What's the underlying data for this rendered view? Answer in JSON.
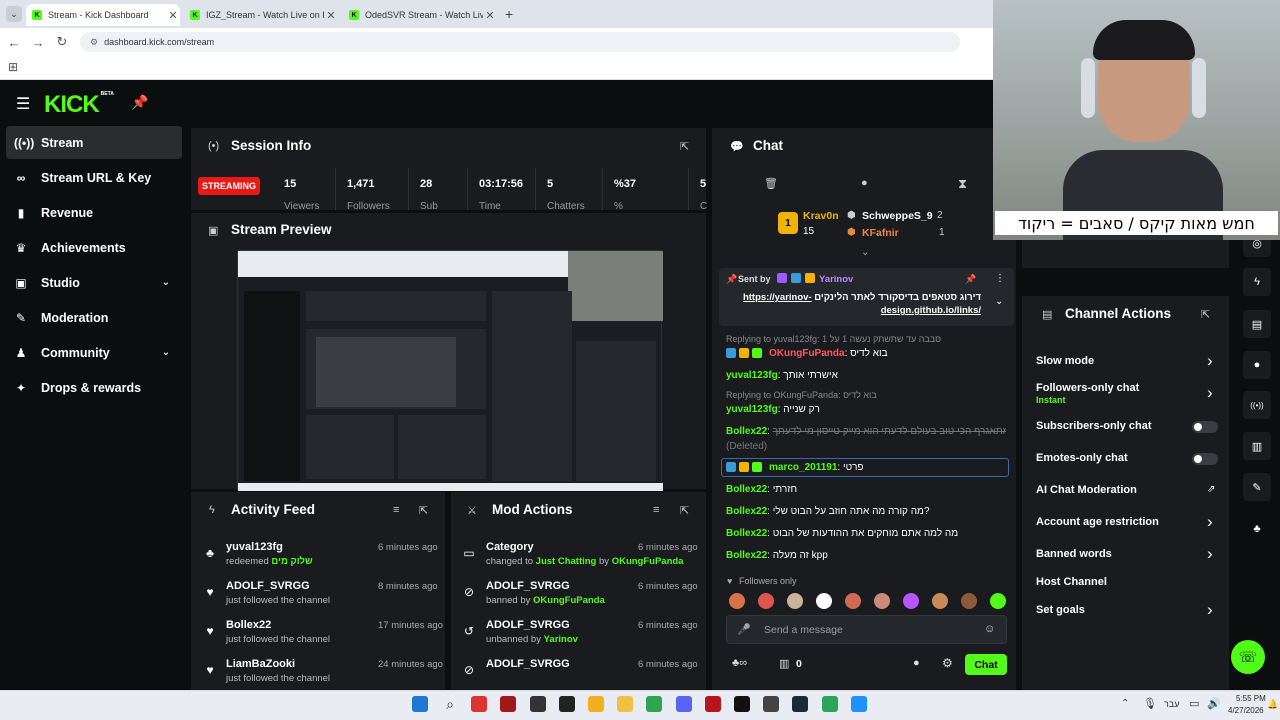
{
  "browser": {
    "tabs": [
      {
        "title": "Stream - Kick Dashboard",
        "active": true
      },
      {
        "title": "IGZ_Stream - Watch Live on Kick",
        "active": false
      },
      {
        "title": "OdedSVR Stream - Watch Live on Kick",
        "active": false
      }
    ],
    "new_tab": "+",
    "url": "dashboard.kick.com/stream"
  },
  "kick": {
    "logo": "KICK",
    "logo_badge": "BETA"
  },
  "sidebar": {
    "items": [
      {
        "label": "Stream",
        "icon": "broadcast-icon",
        "glyph": "((•))",
        "active": true,
        "expandable": false
      },
      {
        "label": "Stream URL & Key",
        "icon": "link-icon",
        "glyph": "∞",
        "active": false,
        "expandable": false
      },
      {
        "label": "Revenue",
        "icon": "chart-icon",
        "glyph": "▮",
        "active": false,
        "expandable": false
      },
      {
        "label": "Achievements",
        "icon": "trophy-icon",
        "glyph": "♛",
        "active": false,
        "expandable": false
      },
      {
        "label": "Studio",
        "icon": "studio-icon",
        "glyph": "▣",
        "active": false,
        "expandable": true
      },
      {
        "label": "Moderation",
        "icon": "wrench-icon",
        "glyph": "✎",
        "active": false,
        "expandable": false
      },
      {
        "label": "Community",
        "icon": "community-icon",
        "glyph": "♟",
        "active": false,
        "expandable": true
      },
      {
        "label": "Drops & rewards",
        "icon": "gift-icon",
        "glyph": "✦",
        "active": false,
        "expandable": false
      }
    ]
  },
  "session": {
    "title": "Session Info",
    "status": "STREAMING",
    "stats": [
      {
        "value": "15",
        "label": "Viewers"
      },
      {
        "value": "1,471",
        "label": "Followers"
      },
      {
        "value": "28",
        "label": "Sub"
      },
      {
        "value": "03:17:56",
        "label": "Time"
      },
      {
        "value": "5",
        "label": "Chatters"
      },
      {
        "value": "%37",
        "label": "%"
      },
      {
        "value": "5",
        "label": "C"
      }
    ]
  },
  "preview": {
    "title": "Stream Preview"
  },
  "activity": {
    "title": "Activity Feed",
    "items": [
      {
        "name": "yuval123fg",
        "sub": "redeemed",
        "extra": "שלוק מים",
        "time": "6 minutes ago",
        "icon": "redeem-icon"
      },
      {
        "name": "ADOLF_SVRGG",
        "sub": "just followed the channel",
        "extra": "",
        "time": "8 minutes ago",
        "icon": "heart-icon"
      },
      {
        "name": "Bollex22",
        "sub": "just followed the channel",
        "extra": "",
        "time": "17 minutes ago",
        "icon": "heart-icon"
      },
      {
        "name": "LiamBaZooki",
        "sub": "just followed the channel",
        "extra": "",
        "time": "24 minutes ago",
        "icon": "heart-icon"
      }
    ]
  },
  "modactions": {
    "title": "Mod Actions",
    "items": [
      {
        "name": "Category",
        "sub": "changed to",
        "extra": "Just Chatting",
        "by": "by",
        "actor": "OKungFuPanda",
        "time": "6 minutes ago",
        "icon": "category-icon"
      },
      {
        "name": "ADOLF_SVRGG",
        "sub": "banned by",
        "extra": "",
        "by": "",
        "actor": "OKungFuPanda",
        "time": "6 minutes ago",
        "icon": "ban-icon"
      },
      {
        "name": "ADOLF_SVRGG",
        "sub": "unbanned by",
        "extra": "",
        "by": "",
        "actor": "Yarinov",
        "time": "6 minutes ago",
        "icon": "unban-icon"
      },
      {
        "name": "ADOLF_SVRGG",
        "sub": "",
        "extra": "",
        "by": "",
        "actor": "",
        "time": "6 minutes ago",
        "icon": "ban-icon"
      }
    ]
  },
  "chat": {
    "title": "Chat",
    "leaderboard": {
      "first": {
        "name": "Krav0n",
        "score": "15"
      },
      "second": {
        "name": "SchweppeS_9",
        "score": "2"
      },
      "third": {
        "name": "KFafnir",
        "score": "1"
      }
    },
    "pinned": {
      "label": "Sent by",
      "user": "Yarinov",
      "text": "דירוג סטאפים בדיסקורד לאתר הלינקים",
      "link": "https://yarinov-design.github.io/links/"
    },
    "messages": [
      {
        "reply": "Replying to yuval123fg: סבבה עד שתשתק נעשה 1 על 1",
        "user": "OKungFuPanda",
        "text": "בוא לדיס",
        "deleted": ""
      },
      {
        "reply": "",
        "user": "yuval123fg",
        "text": "אישרתי אותך",
        "deleted": ""
      },
      {
        "reply": "Replying to OKungFuPanda: בוא לדיס",
        "user": "yuval123fg",
        "text": "רק שנייה",
        "deleted": ""
      },
      {
        "reply": "",
        "user": "Bollex22",
        "text": "המתאגרף הכי טוב בעולם לדעתי הוא מייק טייסון מי לדעתך",
        "deleted": "(Deleted)"
      },
      {
        "reply": "",
        "user": "marco_201191",
        "text": "פרטי",
        "deleted": ""
      },
      {
        "reply": "",
        "user": "Bollex22",
        "text": "חזרתי",
        "deleted": ""
      },
      {
        "reply": "",
        "user": "Bollex22",
        "text": "מה קורה מה אתה חוזב על הבוט שלי?",
        "deleted": ""
      },
      {
        "reply": "",
        "user": "Bollex22",
        "text": "מה למה אתם מוחקים את ההודעות של הבוט",
        "deleted": ""
      },
      {
        "reply": "",
        "user": "Bollex22",
        "text": "זה מעלה kpp",
        "deleted": ""
      }
    ],
    "mode_notice": "Followers only",
    "input_placeholder": "Send a message",
    "points": "0",
    "send_label": "Chat"
  },
  "channel_actions": {
    "title": "Channel Actions",
    "items": [
      {
        "label": "Slow mode",
        "sub": "",
        "control": "arrow"
      },
      {
        "label": "Followers-only chat",
        "sub": "Instant",
        "control": "arrow"
      },
      {
        "label": "Subscribers-only chat",
        "sub": "",
        "control": "toggle"
      },
      {
        "label": "Emotes-only chat",
        "sub": "",
        "control": "toggle"
      },
      {
        "label": "AI Chat Moderation",
        "sub": "",
        "control": "external"
      },
      {
        "label": "Account age restriction",
        "sub": "",
        "control": "arrow"
      },
      {
        "label": "Banned words",
        "sub": "",
        "control": "arrow"
      },
      {
        "label": "Host Channel",
        "sub": "",
        "control": "none"
      },
      {
        "label": "Set goals",
        "sub": "",
        "control": "arrow"
      }
    ]
  },
  "webcam": {
    "overlay_text": "חמש מאות קיקס / סאבים = ריקוד"
  },
  "taskbar": {
    "lang": "עבר",
    "time": "5:55 PM",
    "date": "4/27/2026"
  },
  "colors": {
    "brand": "#53fc18",
    "panel": "#191b1f",
    "bg": "#0b0e0f",
    "streaming": "#e91916"
  }
}
